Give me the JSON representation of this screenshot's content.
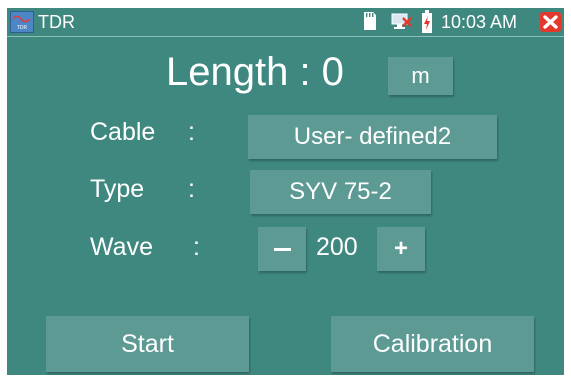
{
  "status_bar": {
    "app_title": "TDR",
    "time": "10:03 AM",
    "app_icon_text": "TDR",
    "icons": [
      "app-icon",
      "sd-card-icon",
      "network-icon",
      "battery-charging-icon",
      "close-icon"
    ],
    "close_color": "#e5382d"
  },
  "measurement": {
    "length_label": "Length : 0",
    "unit": "m"
  },
  "settings": {
    "cable_label": "Cable",
    "cable_value": "User- defined2",
    "type_label": "Type",
    "type_value": "SYV 75-2",
    "wave_label": "Wave",
    "wave_value": "200",
    "decrement_label": "—",
    "increment_label": "+",
    "colon": ":"
  },
  "actions": {
    "start_label": "Start",
    "calibration_label": "Calibration"
  },
  "colors": {
    "background": "#3f8880",
    "button": "#5c9a93",
    "text": "#ffffff"
  }
}
